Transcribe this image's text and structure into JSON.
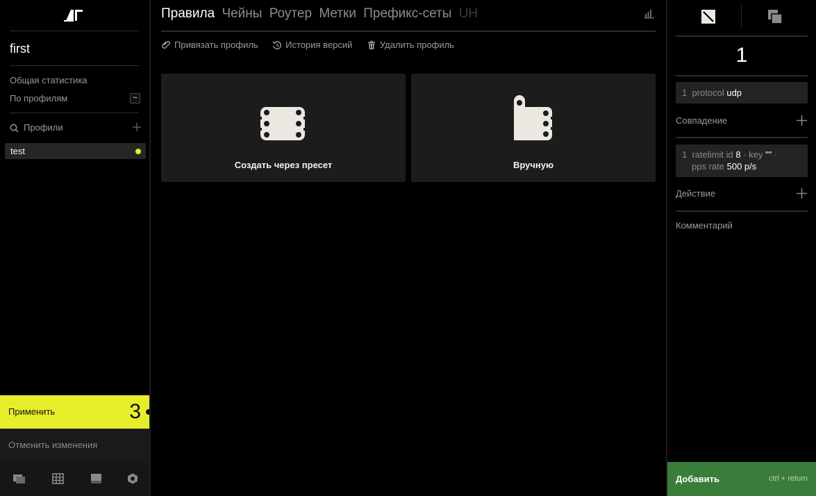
{
  "app": {
    "logo_text": "ΔГ"
  },
  "sidebar": {
    "profile_name": "first",
    "nav": [
      {
        "label": "Общая статистика"
      },
      {
        "label": "По профилям",
        "badge": "~"
      }
    ],
    "search_label": "Профили",
    "profiles": [
      {
        "label": "test",
        "status_color": "#e6ed2a"
      }
    ],
    "apply": {
      "label": "Применить",
      "count": "3"
    },
    "cancel": {
      "label": "Отменить изменения"
    },
    "bottom_icons": [
      "chat-icon",
      "grid-icon",
      "panel-icon",
      "gear-icon"
    ]
  },
  "main": {
    "tabs": [
      {
        "label": "Правила",
        "state": "active"
      },
      {
        "label": "Чейны",
        "state": "normal"
      },
      {
        "label": "Роутер",
        "state": "normal"
      },
      {
        "label": "Метки",
        "state": "normal"
      },
      {
        "label": "Префикс-сеты",
        "state": "normal"
      },
      {
        "label": "UH",
        "state": "disabled"
      }
    ],
    "toolbar": [
      {
        "label": "Привязать профиль",
        "icon": "paperclip-icon"
      },
      {
        "label": "История версий",
        "icon": "history-icon"
      },
      {
        "label": "Удалить профиль",
        "icon": "trash-icon"
      }
    ],
    "cards": [
      {
        "label": "Создать через пресет",
        "icon": "preset-icon"
      },
      {
        "label": "Вручную",
        "icon": "manual-icon"
      }
    ]
  },
  "right_panel": {
    "rule_number": "1",
    "match_rule": {
      "index": "1",
      "key": "protocol",
      "value": "udp"
    },
    "match_section_label": "Совпадение",
    "action_rule": {
      "index": "1",
      "line1_prefix": "ratelimit id",
      "id_value": "8",
      "key_label": "· key",
      "key_value": "\"\"",
      "line1_suffix": "·",
      "line2_prefix": "pps rate",
      "rate_value": "500 p/s"
    },
    "action_section_label": "Действие",
    "comment_label": "Комментарий",
    "add": {
      "label": "Добавить",
      "hint": "ctrl + return"
    }
  },
  "colors": {
    "accent_yellow": "#e6ed2a",
    "add_green": "#3a7d3a",
    "card_bg": "#1c1c1c"
  }
}
